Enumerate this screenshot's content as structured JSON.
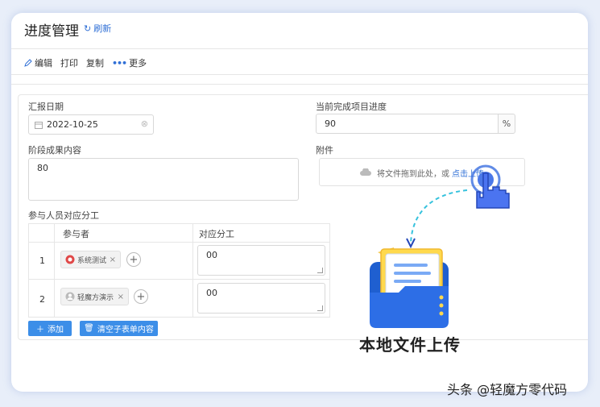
{
  "header": {
    "title": "进度管理",
    "refresh_label": "刷新"
  },
  "toolbar": {
    "edit": "编辑",
    "print": "打印",
    "copy": "复制",
    "more": "更多"
  },
  "form": {
    "report_date": {
      "label": "汇报日期",
      "value": "2022-10-25"
    },
    "progress": {
      "label": "当前完成项目进度",
      "value": "90",
      "unit": "%"
    },
    "stage_result": {
      "label": "阶段成果内容",
      "value": "80"
    },
    "attachment": {
      "label": "附件",
      "drop_text": "将文件拖到此处，或",
      "click_text": "点击上传"
    },
    "participants": {
      "label": "参与人员对应分工",
      "columns": [
        "参与者",
        "对应分工"
      ],
      "rows": [
        {
          "index": "1",
          "user": "系统测试",
          "task": "00"
        },
        {
          "index": "2",
          "user": "轻魔方演示",
          "task": "00"
        }
      ],
      "add_button": "添加",
      "clear_button": "清空子表单内容"
    }
  },
  "overlay": {
    "caption": "本地文件上传"
  },
  "watermark": "头条 @轻魔方零代码",
  "colors": {
    "accent": "#2f6fd6",
    "button": "#3c8ee8",
    "page_bg": "#e8eef9"
  }
}
